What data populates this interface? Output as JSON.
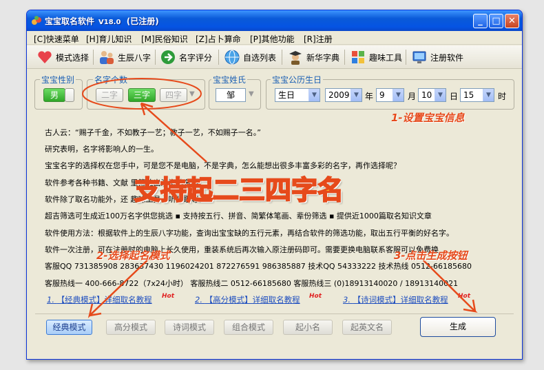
{
  "window": {
    "title": "宝宝取名软件",
    "version": "V18.0",
    "status": "(已注册)",
    "controls": {
      "minimize": "_",
      "maximize": "□",
      "close": "✕"
    }
  },
  "menu": [
    "[C]快速菜单",
    "[H]育儿知识",
    "[M]民俗知识",
    "[Z]占卜算命",
    "[P]其他功能",
    "[R]注册"
  ],
  "toolbar": [
    "模式选择",
    "生辰八字",
    "名字评分",
    "自选列表",
    "新华字典",
    "趣味工具",
    "注册软件"
  ],
  "gender": {
    "label": "宝宝性别",
    "value": "男"
  },
  "name_length": {
    "label": "名字个数",
    "options": [
      "二字",
      "三字",
      "四字"
    ],
    "selected": "三字"
  },
  "surname": {
    "label": "宝宝姓氏",
    "value": "邹"
  },
  "birth": {
    "label": "宝宝公历生日",
    "calendar": "生日",
    "year": "2009",
    "year_unit": "年",
    "month": "9",
    "month_unit": "月",
    "day": "10",
    "day_unit": "日",
    "hour": "15",
    "hour_unit": "时"
  },
  "content_lines": [
    "古人云：“赐子千金，不如教子一艺；教子一艺，不如赐子一名。”",
    "研究表明，名字将影响人的一生。",
    "宝宝名字的选择权在您手中，可是您不是电脑，不是字典，怎么能想出很多丰富多彩的名字，再作选择呢？",
    "软件参考各种书籍、文献                                                                          里筛选出满意的名字",
    "软件除了取名功能外，还                                                                    趣味工具、听儿歌等。",
    "超吉筛选可生成近100万名字供您挑选  ▪  支持按五行、拼音、简繁体笔画、辈份筛选  ▪  提供近1000篇取名知识文章",
    "软件使用方法：根据软件上的生辰八字功能，查询出宝宝缺的五行元素，再结合软件的筛选功能，取出五行平衡的好名字。",
    "软件一次注册，可在注册时的电脑上长久使用，重装系统后再次输入原注册码即可。需要更换电脑联系客服可以免费换",
    "客服QQ  731385908   283637430   1196024201   872276591   986385887   技术QQ 54333222   技术热线 0512-66185680",
    "客服热线一  400-666-8722（7x24小时）  客服热线二 0512-66185680   客服热线三 (0)18913140020 / 18913140021"
  ],
  "tutorials": [
    {
      "num": "1.",
      "text": "【经典模式】详细取名教程",
      "hot": "Hot"
    },
    {
      "num": "2.",
      "text": "【高分模式】详细取名教程",
      "hot": "Hot"
    },
    {
      "num": "3.",
      "text": "【诗词模式】详细取名教程",
      "hot": "Hot"
    }
  ],
  "modes": [
    "经典模式",
    "高分模式",
    "诗词模式",
    "组合模式",
    "起小名",
    "起英文名"
  ],
  "active_mode": "经典模式",
  "generate_button": "生成",
  "annotations": {
    "big": "支持起二三四字名",
    "step1": "1-设置宝宝信息",
    "step2": "2-选择起名模式",
    "step3": "3-点击生成按钮"
  },
  "colors": {
    "title_bar": "#0554e3",
    "accent_green": "#2fa728",
    "annotation": "#e64a1b",
    "link": "#1f4fbf"
  }
}
